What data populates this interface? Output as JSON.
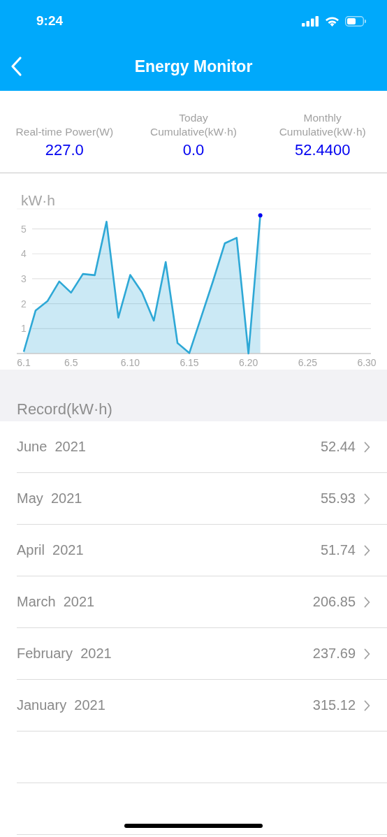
{
  "status_bar": {
    "time": "9:24"
  },
  "nav": {
    "title": "Energy Monitor"
  },
  "summary": [
    {
      "label": "Real-time Power(W)",
      "value": "227.0"
    },
    {
      "label": "Today Cumulative(kW·h)",
      "value": "0.0"
    },
    {
      "label": "Monthly Cumulative(kW·h)",
      "value": "52.4400"
    }
  ],
  "chart": {
    "chart_data": {
      "type": "area",
      "ylabel": "kW·h",
      "categories": [
        "6.1",
        null,
        null,
        null,
        "6.5",
        null,
        null,
        null,
        null,
        "6.10",
        null,
        null,
        null,
        null,
        "6.15",
        null,
        null,
        null,
        null,
        "6.20",
        null,
        null,
        null,
        null,
        "6.25",
        null,
        null,
        null,
        null,
        "6.30"
      ],
      "series": [
        {
          "color": "#2ea8d6",
          "values": [
            0.07,
            1.72,
            2.1,
            2.89,
            2.44,
            3.19,
            3.14,
            5.29,
            1.44,
            3.15,
            2.45,
            1.32,
            3.67,
            0.42,
            0.02,
            1.46,
            2.9,
            4.42,
            4.64,
            0,
            5.54,
            null,
            null,
            null,
            null,
            null,
            null,
            null,
            null,
            null
          ]
        }
      ],
      "ylim": [
        0,
        5.8
      ],
      "grid": true,
      "yticks": [
        {
          "value": 1,
          "label": "1"
        },
        {
          "value": 2,
          "label": "2"
        },
        {
          "value": 3,
          "label": "3"
        },
        {
          "value": 4,
          "label": "4"
        },
        {
          "value": 5,
          "label": "5"
        }
      ]
    }
  },
  "records": {
    "title": "Record(kW·h)",
    "rows": [
      {
        "month": "June  2021",
        "value": "52.44"
      },
      {
        "month": "May  2021",
        "value": "55.93"
      },
      {
        "month": "April  2021",
        "value": "51.74"
      },
      {
        "month": "March  2021",
        "value": "206.85"
      },
      {
        "month": "February  2021",
        "value": "237.69"
      },
      {
        "month": "January  2021",
        "value": "315.12"
      }
    ]
  }
}
